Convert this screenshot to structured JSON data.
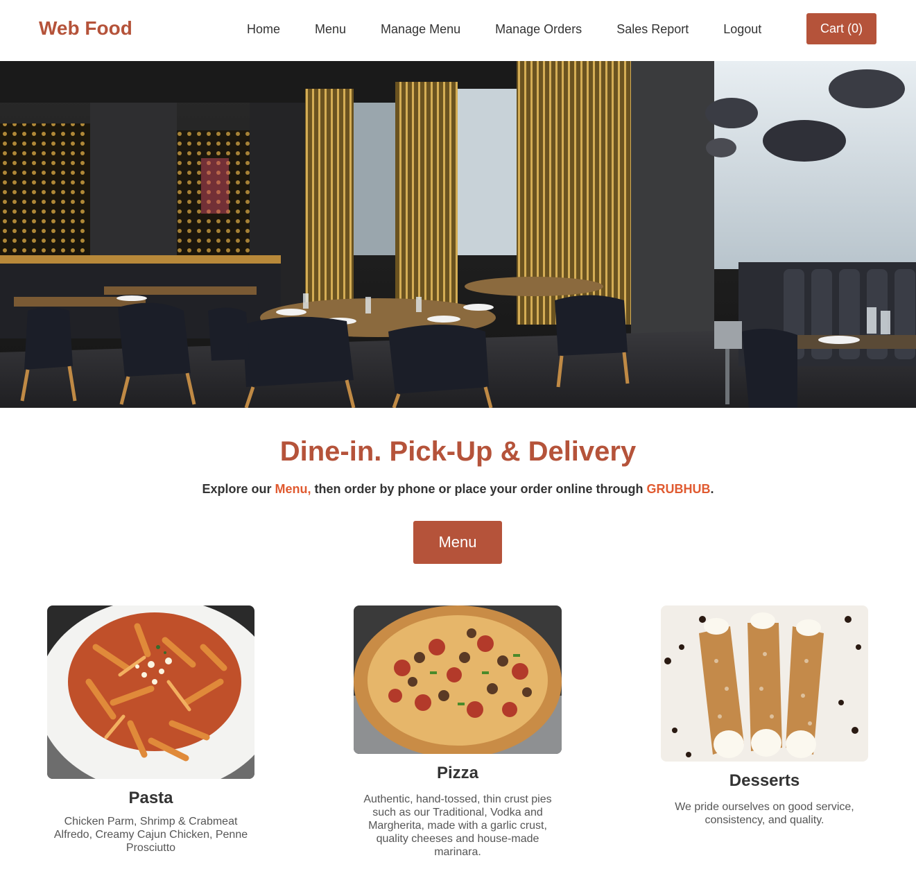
{
  "brand": {
    "name": "Web Food",
    "color": "#b5533a"
  },
  "nav": {
    "items": [
      {
        "label": "Home"
      },
      {
        "label": "Menu"
      },
      {
        "label": "Manage Menu"
      },
      {
        "label": "Manage Orders"
      },
      {
        "label": "Sales Report"
      },
      {
        "label": "Logout"
      }
    ],
    "cart_label": "Cart (0)"
  },
  "hero": {
    "image": "restaurant-interior-photo"
  },
  "intro": {
    "headline": "Dine-in. Pick-Up & Delivery",
    "tagline_prefix": "Explore our ",
    "tagline_menu_link": "Menu,",
    "tagline_middle": " then order by phone or place your order online through ",
    "tagline_grubhub_link": "GRUBHUB",
    "tagline_suffix": ".",
    "menu_button": "Menu"
  },
  "categories": [
    {
      "title": "Pasta",
      "description": "Chicken Parm, Shrimp & Crabmeat Alfredo, Creamy Cajun Chicken, Penne Prosciutto",
      "image": "pasta-photo"
    },
    {
      "title": "Pizza",
      "description": "Authentic, hand-tossed, thin crust pies such as our Traditional, Vodka and Margherita, made with a garlic crust, quality cheeses and house-made marinara.",
      "image": "pizza-photo"
    },
    {
      "title": "Desserts",
      "description": "We pride ourselves on good service, consistency, and quality.",
      "image": "cannoli-photo"
    }
  ],
  "colors": {
    "accent": "#b5533a",
    "link_accent": "#e05a30",
    "text": "#333333"
  }
}
